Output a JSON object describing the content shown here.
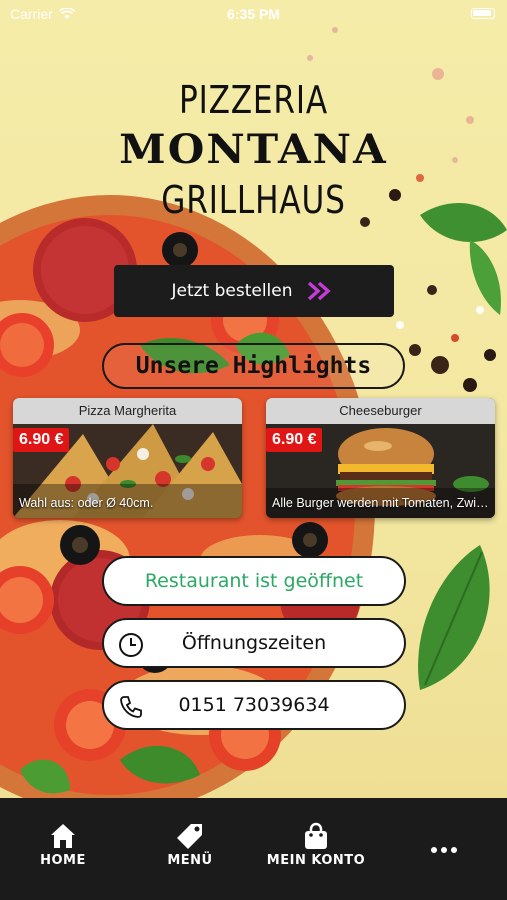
{
  "status_bar": {
    "carrier": "Carrier",
    "time": "6:35 PM"
  },
  "logo": {
    "line1": "PIZZERIA",
    "line2": "MONTANA",
    "line3": "GRILLHAUS"
  },
  "order_button": {
    "label": "Jetzt bestellen",
    "icon": "double-chevron-right-icon",
    "accent": "#c43bd6"
  },
  "highlights": {
    "title": "Unsere Highlights",
    "items": [
      {
        "name": "Pizza Margherita",
        "price": "6.90 €",
        "description": "Wahl aus: oder Ø 40cm."
      },
      {
        "name": "Cheeseburger",
        "price": "6.90 €",
        "description": "Alle Burger werden mit Tomaten, Zwieb..."
      }
    ]
  },
  "info_buttons": {
    "status": "Restaurant ist geöffnet",
    "status_color": "#2aa864",
    "hours": "Öffnungszeiten",
    "phone": "0151 73039634"
  },
  "tab_bar": {
    "items": [
      {
        "label": "HOME",
        "icon": "home-icon"
      },
      {
        "label": "MENÜ",
        "icon": "tag-icon"
      },
      {
        "label": "MEIN KONTO",
        "icon": "shopping-bag-icon"
      },
      {
        "label": "",
        "icon": "more-icon"
      }
    ]
  },
  "colors": {
    "price_badge": "#e01616",
    "tab_bar_bg": "#1b1b1b",
    "background": "#f3e8a6"
  }
}
